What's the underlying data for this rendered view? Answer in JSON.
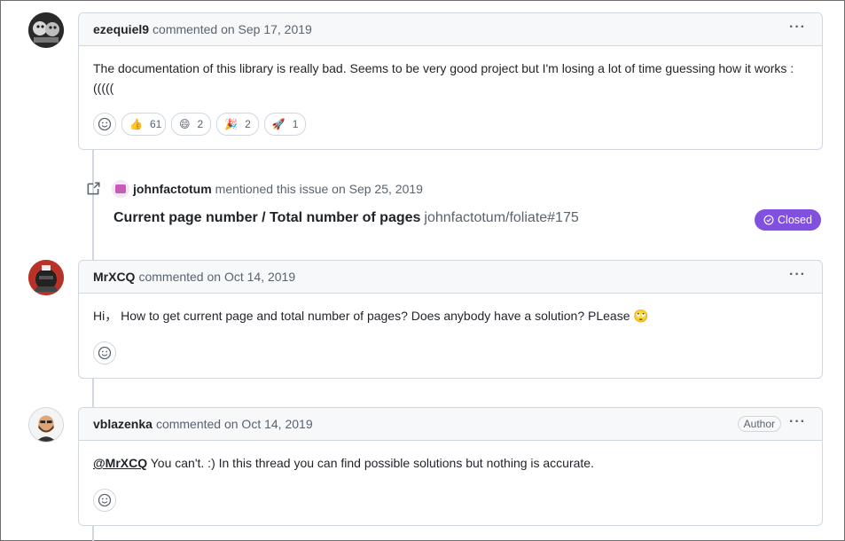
{
  "comment1": {
    "author": "ezequiel9",
    "meta": "commented on Sep 17, 2019",
    "body": "The documentation of this library is really bad. Seems to be very good project but I'm losing a lot of time guessing how it works :(((((",
    "reactions": [
      {
        "emoji": "👍",
        "count": "61"
      },
      {
        "emoji": "😄",
        "count": "2"
      },
      {
        "emoji": "🎉",
        "count": "2"
      },
      {
        "emoji": "🚀",
        "count": "1"
      }
    ]
  },
  "mention": {
    "user": "johnfactotum",
    "meta": "mentioned this issue on Sep 25, 2019",
    "ref_title": "Current page number / Total number of pages",
    "ref_repo": "johnfactotum/foliate#175",
    "status": "Closed"
  },
  "comment2": {
    "author": "MrXCQ",
    "meta": "commented on Oct 14, 2019",
    "body": "Hi，  How to get current page and total number of pages? Does anybody have a solution? PLease 🙄"
  },
  "comment3": {
    "author": "vblazenka",
    "meta": "commented on Oct 14, 2019",
    "badge": "Author",
    "mention": "@MrXCQ",
    "body": " You can't. :) In this thread you can find possible solutions but nothing is accurate."
  },
  "ui": {
    "more_label": "···"
  },
  "colors": {
    "border": "#d0d7de",
    "header_bg": "#f6f8fa",
    "closed": "#8250df"
  }
}
